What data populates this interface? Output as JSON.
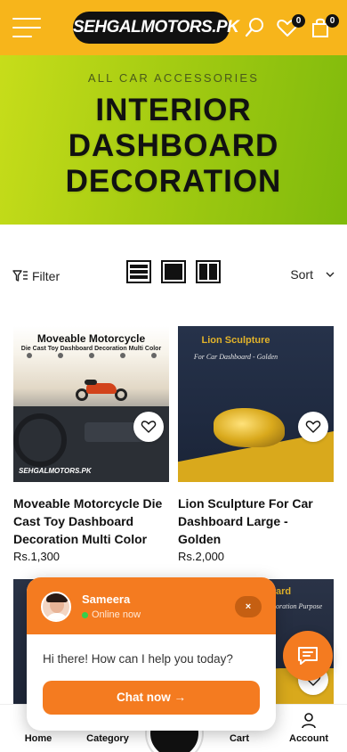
{
  "header": {
    "logo_text": "SEHGALMOTORS.PK",
    "wishlist_count": "0",
    "cart_count": "0",
    "brand_color": "#f7b51b",
    "icons": [
      "menu-icon",
      "search-icon",
      "heart-icon",
      "bag-icon"
    ]
  },
  "hero": {
    "subtitle": "ALL CAR ACCESSORIES",
    "title_line1": "INTERIOR",
    "title_line2": "DASHBOARD",
    "title_line3": "DECORATION"
  },
  "toolbar": {
    "filter_label": "Filter",
    "sort_label": "Sort"
  },
  "products": [
    {
      "title": "Moveable Motorcycle Die Cast Toy Dashboard Decoration Multi Color",
      "price": "Rs.1,300",
      "image_heading": "Moveable Motorcycle",
      "image_subheading": "Die Cast Toy Dashboard Decoration Multi Color",
      "image_logo": "SEHGALMOTORS.PK"
    },
    {
      "title": "Lion Sculpture For Car Dashboard Large - Golden",
      "price": "Rs.2,000",
      "image_heading": "Lion Sculpture",
      "image_subheading": "For Car Dashboard - Golden"
    },
    {
      "image_partial_text_1": "ard",
      "image_partial_text_2": "oration Purpose"
    }
  ],
  "chat": {
    "agent_name": "Sameera",
    "status": "Online now",
    "close_label": "×",
    "message": "Hi there! How can I help you today?",
    "button_label": "Chat now →",
    "accent_color": "#f47b20"
  },
  "bottom_nav": {
    "items": [
      {
        "label": "Home"
      },
      {
        "label": "Category"
      },
      {
        "label": ""
      },
      {
        "label": "Cart"
      },
      {
        "label": "Account"
      }
    ]
  }
}
